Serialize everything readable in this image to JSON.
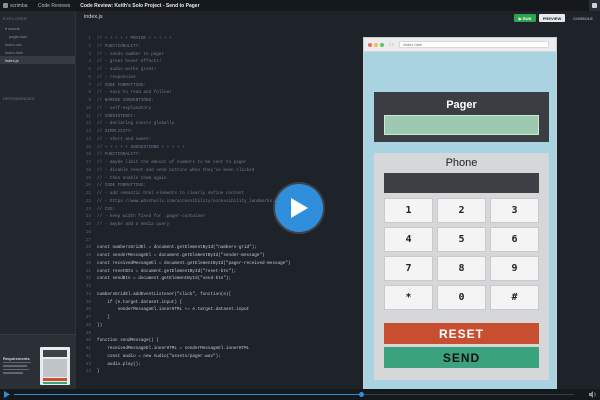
{
  "topbar": {
    "brand": "scrimba",
    "crumb": "Code Reviews",
    "title": "Code Review: Keith's Solo Project - Send to Pager"
  },
  "sidebar": {
    "explorer_label": "EXPLORER",
    "items": [
      {
        "label": "assets",
        "kind": "folder"
      },
      {
        "label": "pager.wav",
        "kind": "file"
      },
      {
        "label": "index.css",
        "kind": "file"
      },
      {
        "label": "index.html",
        "kind": "file"
      },
      {
        "label": "index.js",
        "kind": "file",
        "active": true
      }
    ],
    "deps_label": "DEPENDENCIES",
    "requirements_label": "Requirements"
  },
  "editor": {
    "filename": "index.js",
    "run_label": "RUN",
    "preview_label": "PREVIEW",
    "console_label": "CONSOLE",
    "lines": [
      {
        "n": "1",
        "t": "// + + + + + PRAISE + + + + +",
        "c": "cm"
      },
      {
        "n": "2",
        "t": "// FUNCTIONALITY:",
        "c": "cm"
      },
      {
        "n": "3",
        "t": "// - sends number to pager",
        "c": "cm"
      },
      {
        "n": "4",
        "t": "// - great hover effects!",
        "c": "cm"
      },
      {
        "n": "5",
        "t": "// - audio works great!",
        "c": "cm"
      },
      {
        "n": "6",
        "t": "// - responsive",
        "c": "cm"
      },
      {
        "n": "7",
        "t": "// CODE FORMATTING:",
        "c": "cm"
      },
      {
        "n": "8",
        "t": "// - easy to read and follow!",
        "c": "cm"
      },
      {
        "n": "9",
        "t": "// NAMING CONVENTIONS:",
        "c": "cm"
      },
      {
        "n": "10",
        "t": "// - self-explanatory",
        "c": "cm"
      },
      {
        "n": "11",
        "t": "// CONSISTENCY:",
        "c": "cm"
      },
      {
        "n": "12",
        "t": "// - declaring consts globally",
        "c": "cm"
      },
      {
        "n": "13",
        "t": "// SIMPLICITY:",
        "c": "cm"
      },
      {
        "n": "14",
        "t": "// - short and sweet!",
        "c": "cm"
      },
      {
        "n": "15",
        "t": "// + + + + + SUGGESTIONS + + + + +",
        "c": "cm"
      },
      {
        "n": "16",
        "t": "// FUNCTIONALITY:",
        "c": "cm"
      },
      {
        "n": "17",
        "t": "// - maybe limit the amount of numbers to be sent to pager",
        "c": "cm"
      },
      {
        "n": "18",
        "t": "// - disable reset and send buttons when they've been clicked",
        "c": "cm"
      },
      {
        "n": "19",
        "t": "// - then enable them again",
        "c": "cm"
      },
      {
        "n": "20",
        "t": "// CODE FORMATTING:",
        "c": "cm"
      },
      {
        "n": "21",
        "t": "// - add semantic html elements to clearly define content",
        "c": "cm"
      },
      {
        "n": "22",
        "t": "// - https://www.w3schools.com/accessibility/accessibility_landmarks.php",
        "c": "cm"
      },
      {
        "n": "23",
        "t": "// CSS:",
        "c": "cm"
      },
      {
        "n": "24",
        "t": "// - keep width fixed for .pager-container",
        "c": "cm"
      },
      {
        "n": "25",
        "t": "// - maybe add a media query",
        "c": "cm"
      },
      {
        "n": "26",
        "t": "",
        "c": ""
      },
      {
        "n": "27",
        "t": "",
        "c": ""
      },
      {
        "n": "28",
        "t": "const numbersGridEl = document.getElementById(\"numbers-grid\");",
        "c": ""
      },
      {
        "n": "29",
        "t": "const senderMessageEl = document.getElementById(\"sender-message\")",
        "c": ""
      },
      {
        "n": "30",
        "t": "const receivedMessageEl = document.getElementById(\"pager-received-message\")",
        "c": ""
      },
      {
        "n": "31",
        "t": "const resetBtn = document.getElementById(\"reset-btn\");",
        "c": ""
      },
      {
        "n": "32",
        "t": "const sendBtn = document.getElementById(\"send-btn\");",
        "c": ""
      },
      {
        "n": "33",
        "t": "",
        "c": ""
      },
      {
        "n": "34",
        "t": "numbersGridEl.addEventListener(\"click\", function(e){",
        "c": ""
      },
      {
        "n": "35",
        "t": "    if (e.target.dataset.input) {",
        "c": ""
      },
      {
        "n": "36",
        "t": "        senderMessageEl.innerHTML += e.target.dataset.input",
        "c": ""
      },
      {
        "n": "37",
        "t": "    }",
        "c": ""
      },
      {
        "n": "38",
        "t": "})",
        "c": ""
      },
      {
        "n": "39",
        "t": "",
        "c": ""
      },
      {
        "n": "40",
        "t": "function sendMessage() {",
        "c": ""
      },
      {
        "n": "41",
        "t": "    receivedMessageEl.innerHTML = senderMessageEl.innerHTML",
        "c": ""
      },
      {
        "n": "42",
        "t": "    const audio = new Audio(\"assets/pager.wav\");",
        "c": ""
      },
      {
        "n": "43",
        "t": "    audio.play();",
        "c": ""
      },
      {
        "n": "44",
        "t": "}",
        "c": ""
      }
    ]
  },
  "browser": {
    "url": "/index.html",
    "pager_title": "Pager",
    "phone_title": "Phone",
    "keys": [
      "1",
      "2",
      "3",
      "4",
      "5",
      "6",
      "7",
      "8",
      "9",
      "*",
      "0",
      "#"
    ],
    "reset_label": "RESET",
    "send_label": "SEND"
  },
  "player": {
    "progress": 0.62
  },
  "colors": {
    "accent": "#2f8fdc",
    "run": "#2ea44f",
    "reset": "#c74e2f",
    "send": "#3aa37e"
  }
}
